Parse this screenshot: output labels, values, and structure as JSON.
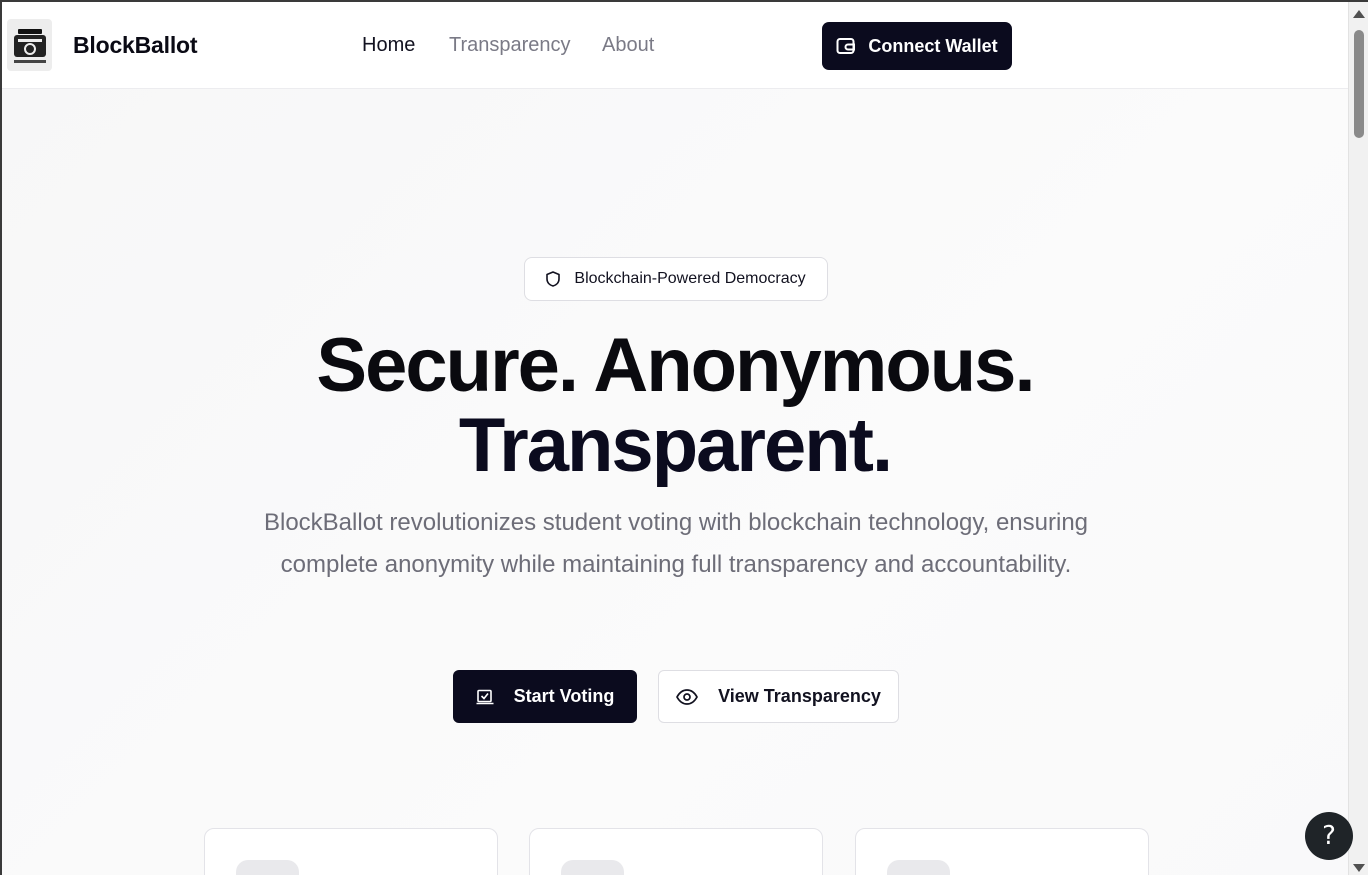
{
  "header": {
    "brand": "BlockBallot",
    "nav": [
      {
        "label": "Home",
        "active": true
      },
      {
        "label": "Transparency",
        "active": false
      },
      {
        "label": "About",
        "active": false
      }
    ],
    "connect_label": "Connect Wallet"
  },
  "hero": {
    "badge": "Blockchain-Powered Democracy",
    "headline_line1": "Secure. Anonymous.",
    "headline_line2": "Transparent.",
    "subtitle": "BlockBallot revolutionizes student voting with blockchain technology, ensuring complete anonymity while maintaining full transparency and accountability.",
    "start_label": "Start Voting",
    "view_label": "View Transparency"
  },
  "help": {
    "label": "?"
  },
  "icons": {
    "logo": "ballot-box-logo",
    "wallet": "wallet-icon",
    "shield": "shield-icon",
    "vote": "vote-checkbox-icon",
    "eye": "eye-icon"
  },
  "colors": {
    "primary": "#0b0b1e",
    "muted_text": "#6d6d78",
    "nav_inactive": "#7a7a86"
  }
}
